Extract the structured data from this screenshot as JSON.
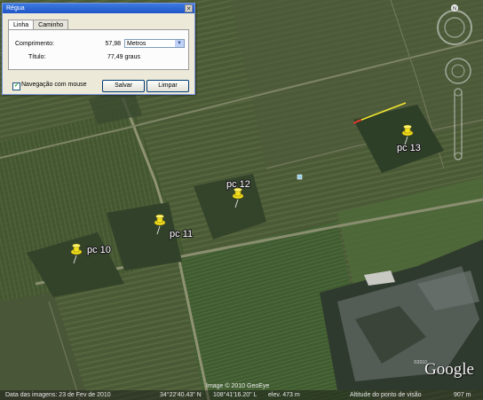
{
  "dialog": {
    "title": "Régua",
    "close_label": "✕",
    "tabs": [
      {
        "label": "Linha",
        "active": true
      },
      {
        "label": "Caminho",
        "active": false
      }
    ],
    "length_label": "Comprimento:",
    "length_value": "57,98",
    "unit_selected": "Metros",
    "heading_label": "Título:",
    "heading_value": "77,49 graus",
    "mouse_nav_label": "Navegação com mouse",
    "mouse_nav_checked": true,
    "save_label": "Salvar",
    "clear_label": "Limpar"
  },
  "placemarks": [
    {
      "label": "pc 10"
    },
    {
      "label": "pc 11"
    },
    {
      "label": "pc 12"
    },
    {
      "label": "pc 13"
    }
  ],
  "map": {
    "imagery_credit": "Image © 2010 GeoEye",
    "copyright": "©2010",
    "logo": "Google",
    "north_label": "N"
  },
  "status": {
    "imagery_date": "Data das imagens: 23 de Fev de 2010",
    "latitude": "34°22'40.43\" N",
    "longitude": "108°41'16.20\" L",
    "elevation": "elev. 473 m",
    "eye_altitude_label": "Altitude do ponto de visão",
    "eye_altitude_value": "907 m"
  },
  "colors": {
    "pin": "#f5e21c",
    "ruler_line": "#f2e530",
    "ruler_start": "#e0362b"
  }
}
